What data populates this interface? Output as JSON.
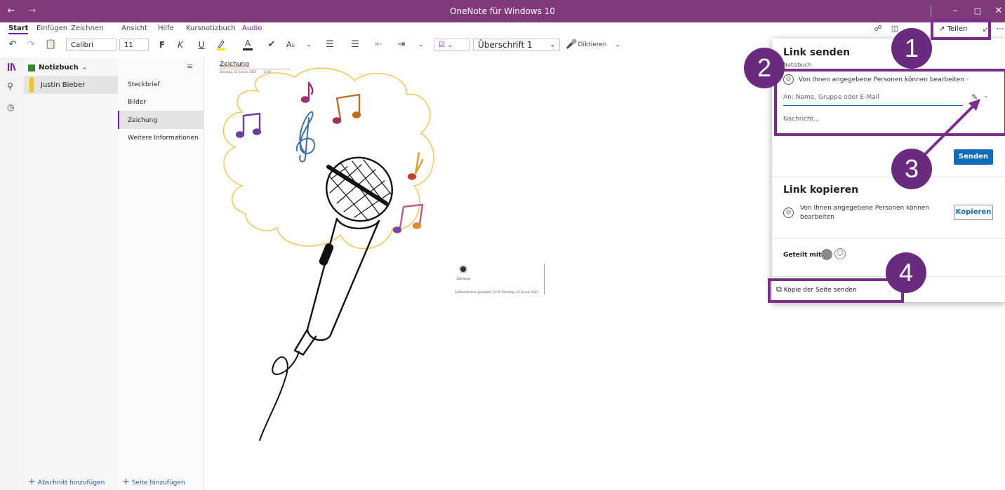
{
  "window": {
    "title": "OneNote für Windows 10"
  },
  "ribbon": {
    "tabs": [
      "Start",
      "Einfügen",
      "Zeichnen",
      "Ansicht",
      "Hilfe",
      "Kursnotizbuch",
      "Audio"
    ],
    "font_name": "Calibri",
    "font_size": "11",
    "style": "Überschrift 1",
    "dictate": "Diktieren",
    "share": "Teilen"
  },
  "notebook": {
    "name": "Notizbuch"
  },
  "sections": [
    {
      "label": "Justin Bieber",
      "color": "#f0c419"
    }
  ],
  "pages": [
    "Steckbrief",
    "Bilder",
    "Zeichung",
    "Weitere Informationen"
  ],
  "footer": {
    "add_section": "Abschnitt hinzufügen",
    "add_page": "Seite hinzufügen"
  },
  "canvas": {
    "page_title": "Zeichung",
    "page_date": "Dienstag, 24. Januar 2023",
    "page_time": "13:06",
    "audio_label": "Zeichung",
    "audio_caption": "Audioaufnahme gestartet: 13:45 Dienstag, 24. Januar 2023"
  },
  "share_panel": {
    "send_link_title": "Link senden",
    "send_link_subtitle": "Notizbuch",
    "permission": "Von Ihnen angegebene Personen können bearbeiten",
    "to_placeholder": "An: Name, Gruppe oder E-Mail",
    "message_placeholder": "Nachricht...",
    "send_button": "Senden",
    "copy_link_title": "Link kopieren",
    "copy_permission_line1": "Von Ihnen angegebene Personen können",
    "copy_permission_line2": "bearbeiten",
    "copy_button": "Kopieren",
    "shared_with": "Geteilt mit:",
    "send_copy": "Kopie der Seite senden"
  },
  "callouts": [
    "1",
    "2",
    "3",
    "4"
  ],
  "colors": {
    "accent": "#80397b",
    "callout": "#6a2b7e",
    "primary_button": "#0f6cbd",
    "section_yellow": "#f0c419"
  }
}
